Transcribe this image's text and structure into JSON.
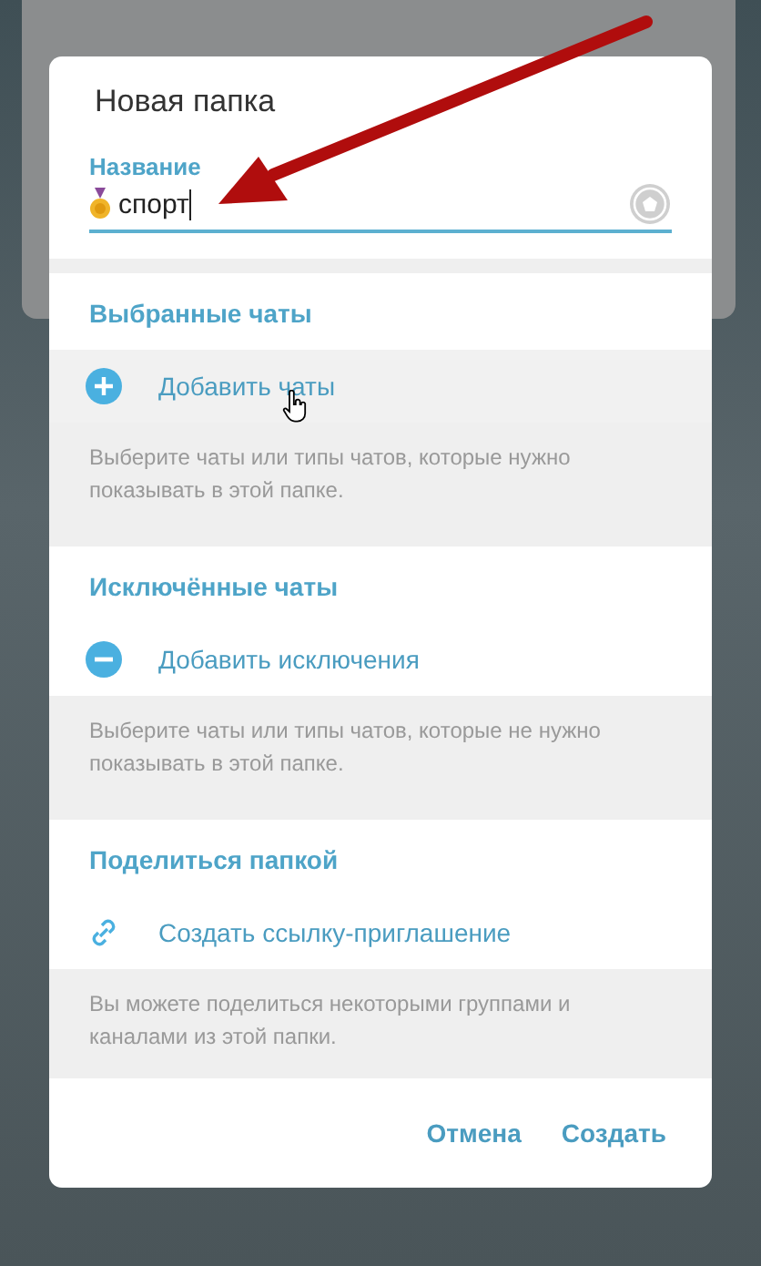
{
  "dialog": {
    "title": "Новая папка",
    "name_field": {
      "label": "Название",
      "value": "спорт",
      "focused": true
    },
    "sections": [
      {
        "title": "Выбранные чаты",
        "action": {
          "kind": "add",
          "label": "Добавить чаты",
          "hovered": true
        },
        "hint": "Выберите чаты или типы чатов, которые нужно показывать в этой папке."
      },
      {
        "title": "Исключённые чаты",
        "action": {
          "kind": "remove",
          "label": "Добавить исключения",
          "hovered": false
        },
        "hint": "Выберите чаты или типы чатов, которые не нужно показывать в этой папке."
      },
      {
        "title": "Поделиться папкой",
        "action": {
          "kind": "link",
          "label": "Создать ссылку-приглашение",
          "hovered": false
        },
        "hint": "Вы можете поделиться некоторыми группами и каналами из этой папки."
      }
    ],
    "buttons": [
      "Отмена",
      "Создать"
    ]
  }
}
